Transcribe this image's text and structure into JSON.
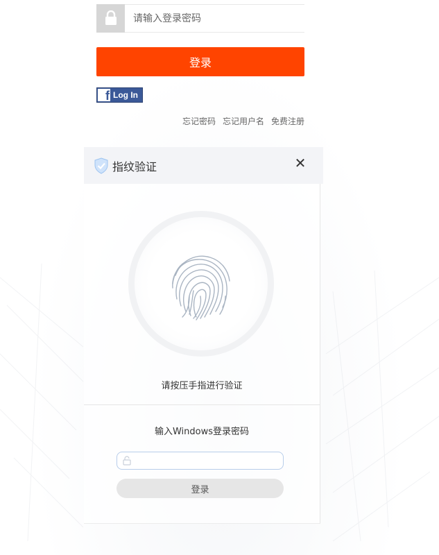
{
  "login": {
    "password_placeholder": "请输入登录密码",
    "login_label": "登录",
    "facebook_label": "Log In",
    "facebook_letter": "f",
    "lock_icon": "lock-icon"
  },
  "links": {
    "forgot_password": "忘记密码",
    "forgot_username": "忘记用户名",
    "free_register": "免费注册"
  },
  "fingerprint_dialog": {
    "title": "指纹验证",
    "close_symbol": "✕",
    "hint": "请按压手指进行验证",
    "windows_label": "输入Windows登录密码",
    "windows_password_placeholder": "",
    "windows_login_label": "登录"
  },
  "colors": {
    "primary": "#ff4400",
    "facebook": "#3b5998",
    "shield": "#4a90e2"
  }
}
